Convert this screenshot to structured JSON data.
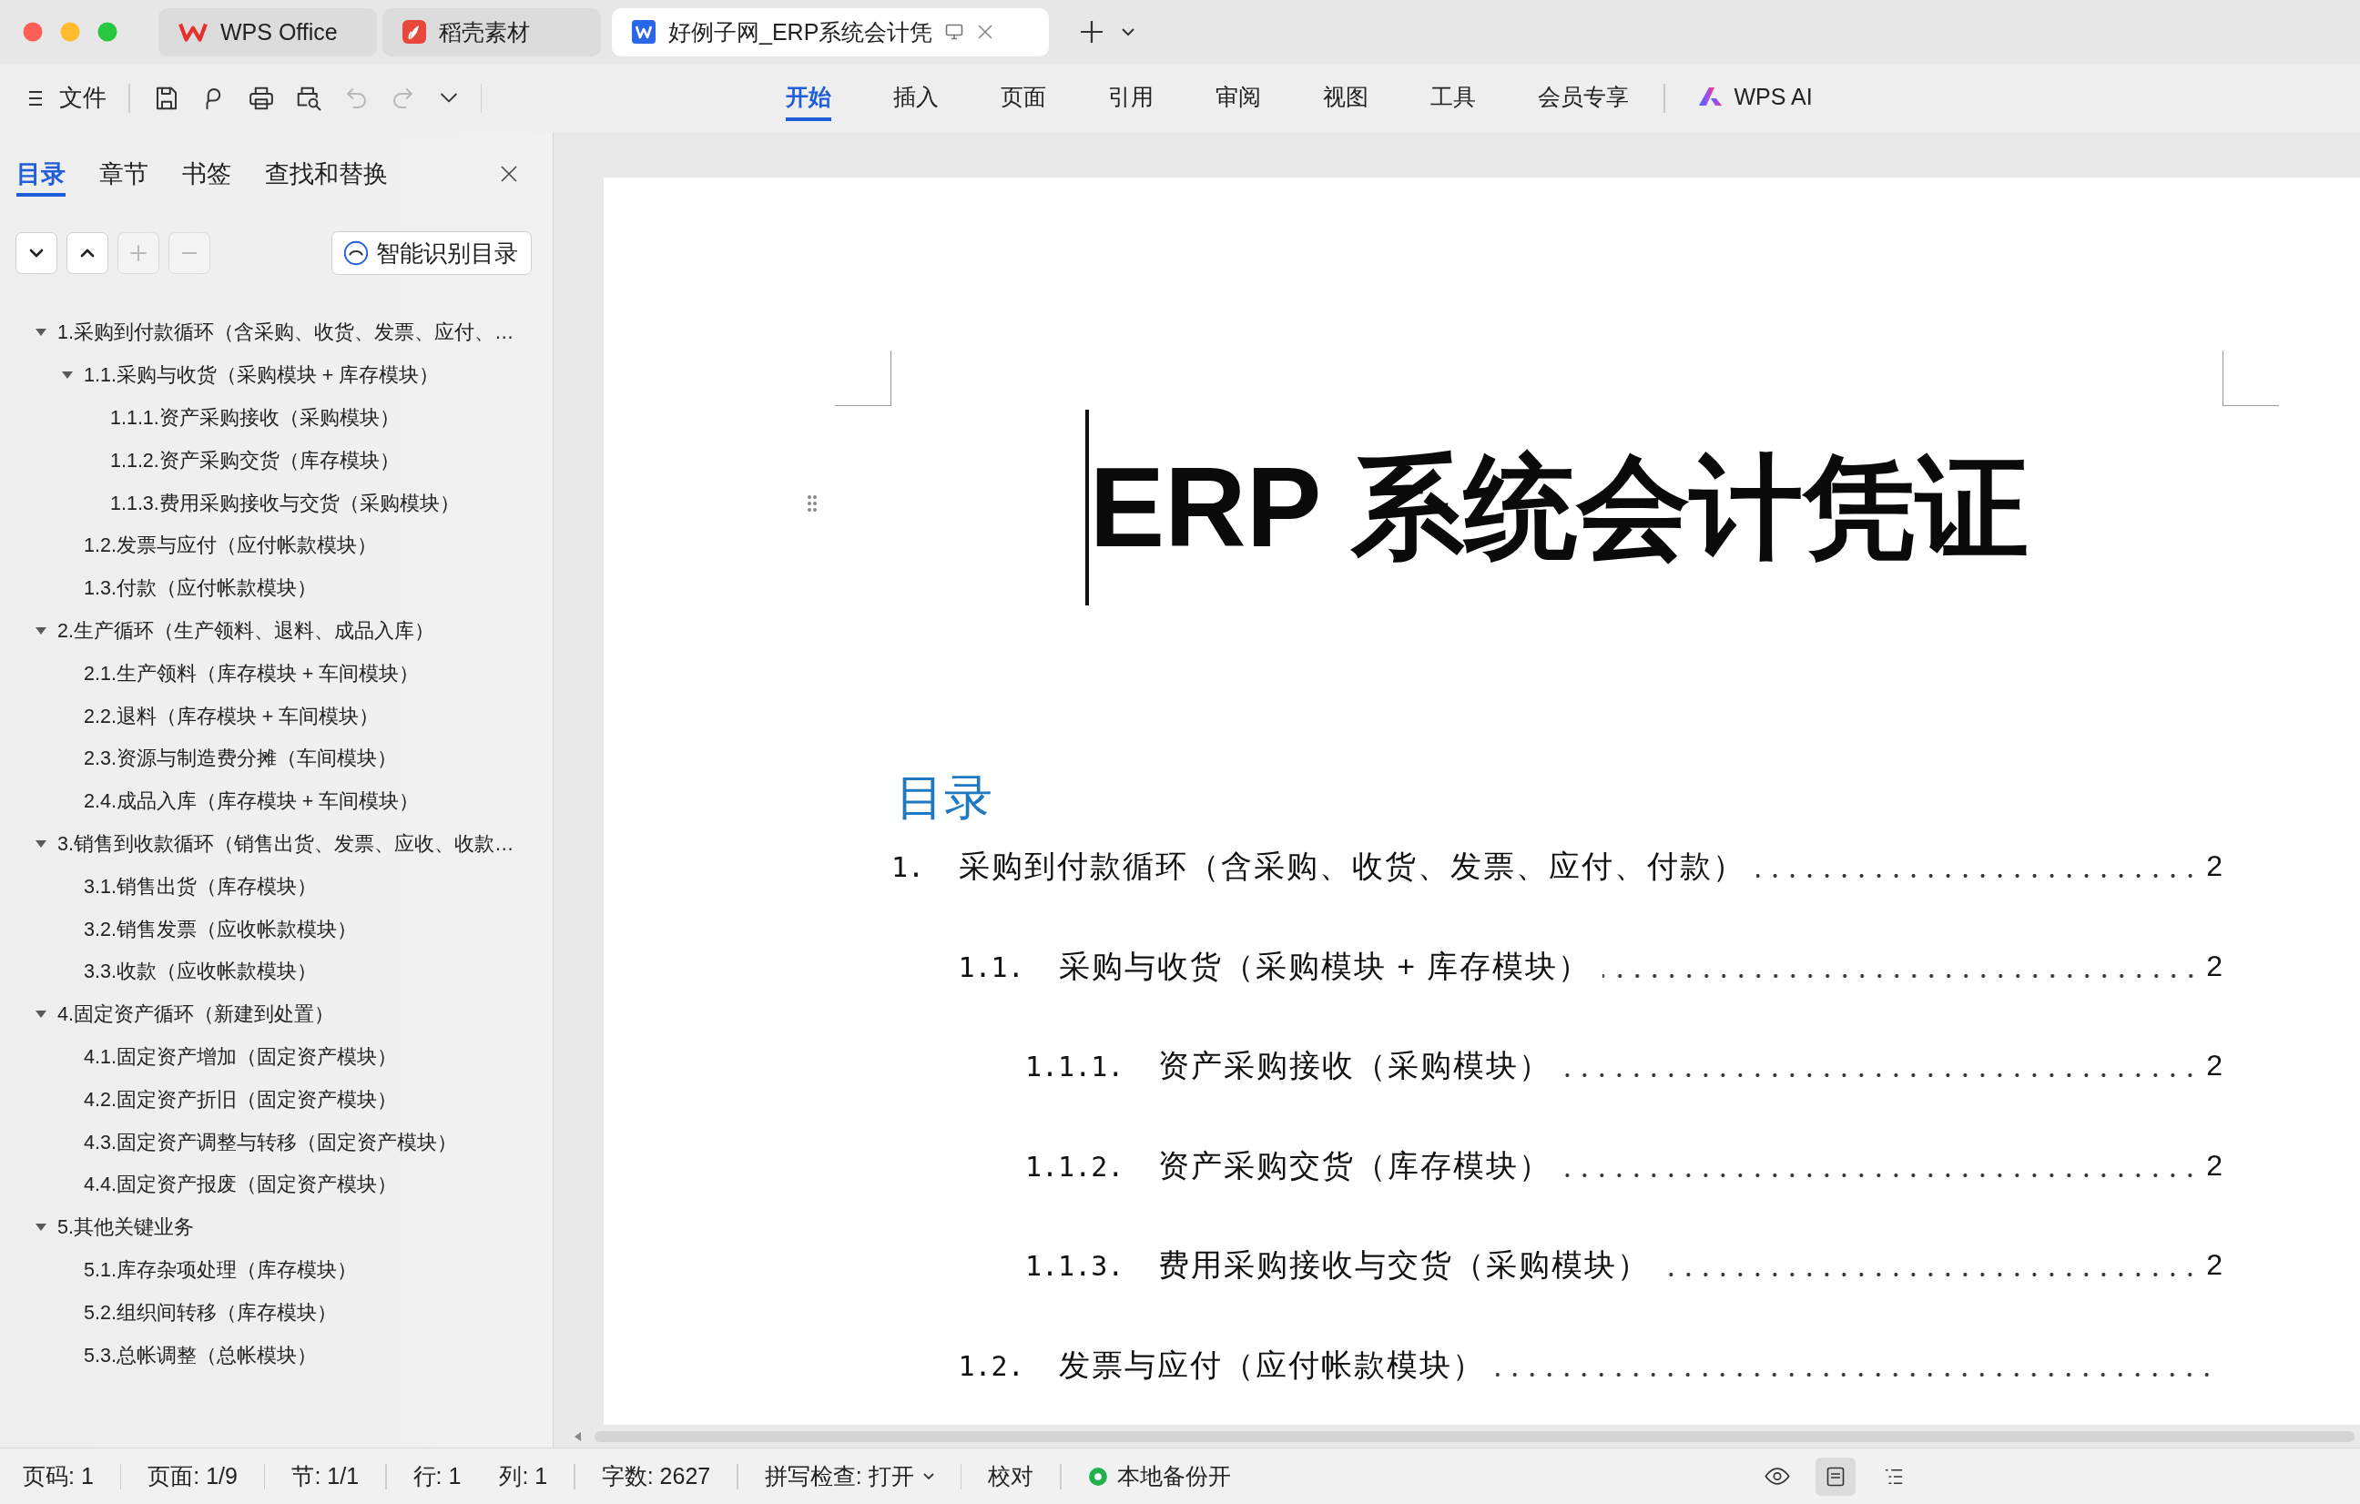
{
  "title_bar": {
    "tabs": [
      {
        "label": "WPS Office",
        "kind": "home",
        "selected": false
      },
      {
        "label": "稻壳素材",
        "kind": "store",
        "selected": false
      },
      {
        "label": "好例子网_ERP系统会计凭",
        "kind": "document",
        "selected": true
      }
    ]
  },
  "toolbar": {
    "file_menu": "文件",
    "quick_tools": [
      {
        "kind": "save",
        "disabled": false
      },
      {
        "kind": "export",
        "disabled": false
      },
      {
        "kind": "print",
        "disabled": false
      },
      {
        "kind": "preview",
        "disabled": false
      },
      {
        "kind": "undo",
        "disabled": true
      },
      {
        "kind": "redo",
        "disabled": true
      },
      {
        "kind": "more",
        "disabled": false
      }
    ],
    "ribbon_tabs": [
      {
        "label": "开始",
        "kind": "tab",
        "selected": true
      },
      {
        "label": "插入",
        "kind": "tab",
        "selected": false
      },
      {
        "label": "页面",
        "kind": "tab",
        "selected": false
      },
      {
        "label": "引用",
        "kind": "tab",
        "selected": false
      },
      {
        "label": "审阅",
        "kind": "tab",
        "selected": false
      },
      {
        "label": "视图",
        "kind": "tab",
        "selected": false
      },
      {
        "label": "工具",
        "kind": "tab",
        "selected": false
      },
      {
        "label": "会员专享",
        "kind": "tab",
        "selected": false
      },
      {
        "label": "WPS AI",
        "kind": "ai",
        "selected": false
      }
    ]
  },
  "sidebar": {
    "tabs": [
      {
        "label": "目录",
        "selected": true
      },
      {
        "label": "章节",
        "selected": false
      },
      {
        "label": "书签",
        "selected": false
      },
      {
        "label": "查找和替换",
        "selected": false
      }
    ],
    "tools": [
      {
        "kind": "down",
        "disabled": false
      },
      {
        "kind": "up",
        "disabled": false
      },
      {
        "kind": "add",
        "disabled": true
      },
      {
        "kind": "remove",
        "disabled": true
      }
    ],
    "smart_button": "智能识别目录",
    "tree": [
      {
        "label": "1.采购到付款循环（含采购、收货、发票、应付、…",
        "expanded": true,
        "children": [
          {
            "label": "1.1.采购与收货（采购模块 + 库存模块）",
            "expanded": true,
            "children": [
              {
                "label": "1.1.1.资产采购接收（采购模块）"
              },
              {
                "label": "1.1.2.资产采购交货（库存模块）"
              },
              {
                "label": "1.1.3.费用采购接收与交货（采购模块）"
              }
            ]
          },
          {
            "label": "1.2.发票与应付（应付帐款模块）"
          },
          {
            "label": "1.3.付款（应付帐款模块）"
          }
        ]
      },
      {
        "label": "2.生产循环（生产领料、退料、成品入库）",
        "expanded": true,
        "children": [
          {
            "label": "2.1.生产领料（库存模块 + 车间模块）"
          },
          {
            "label": "2.2.退料（库存模块 + 车间模块）"
          },
          {
            "label": "2.3.资源与制造费分摊（车间模块）"
          },
          {
            "label": "2.4.成品入库（库存模块 + 车间模块）"
          }
        ]
      },
      {
        "label": "3.销售到收款循环（销售出货、发票、应收、收款…",
        "expanded": true,
        "children": [
          {
            "label": "3.1.销售出货（库存模块）"
          },
          {
            "label": "3.2.销售发票（应收帐款模块）"
          },
          {
            "label": "3.3.收款（应收帐款模块）"
          }
        ]
      },
      {
        "label": "4.固定资产循环（新建到处置）",
        "expanded": true,
        "children": [
          {
            "label": "4.1.固定资产增加（固定资产模块）"
          },
          {
            "label": "4.2.固定资产折旧（固定资产模块）"
          },
          {
            "label": "4.3.固定资产调整与转移（固定资产模块）"
          },
          {
            "label": "4.4.固定资产报废（固定资产模块）"
          }
        ]
      },
      {
        "label": "5.其他关键业务",
        "expanded": true,
        "children": [
          {
            "label": "5.1.库存杂项处理（库存模块）"
          },
          {
            "label": "5.2.组织间转移（库存模块）"
          },
          {
            "label": "5.3.总帐调整（总帐模块）"
          }
        ]
      }
    ]
  },
  "document": {
    "title": "ERP 系统会计凭证",
    "toc_heading": "目录",
    "toc": [
      {
        "number": "1.",
        "text": "采购到付款循环（含采购、收货、发票、应付、付款）",
        "page": "2",
        "children": [
          {
            "number": "1.1.",
            "text": "采购与收货（采购模块 + 库存模块）",
            "page": "2",
            "children": [
              {
                "number": "1.1.1.",
                "text": "资产采购接收（采购模块）",
                "page": "2"
              },
              {
                "number": "1.1.2.",
                "text": "资产采购交货（库存模块）",
                "page": "2"
              },
              {
                "number": "1.1.3.",
                "text": "费用采购接收与交货（采购模块）",
                "page": "2"
              }
            ]
          },
          {
            "number": "1.2.",
            "text": "发票与应付（应付帐款模块）"
          }
        ]
      }
    ]
  },
  "status_bar": {
    "groups": [
      {
        "items": [
          {
            "kind": "text",
            "text": "页码: 1"
          }
        ]
      },
      {
        "items": [
          {
            "kind": "text",
            "text": "页面: 1/9"
          }
        ]
      },
      {
        "items": [
          {
            "kind": "text",
            "text": "节: 1/1"
          }
        ]
      },
      {
        "items": [
          {
            "kind": "text",
            "text": "行: 1"
          },
          {
            "kind": "text",
            "text": "列: 1"
          }
        ]
      },
      {
        "items": [
          {
            "kind": "text",
            "text": "字数: 2627"
          }
        ]
      },
      {
        "items": [
          {
            "kind": "dropdown",
            "text": "拼写检查: 打开"
          }
        ]
      },
      {
        "items": [
          {
            "kind": "button",
            "text": "校对"
          }
        ]
      },
      {
        "items": [
          {
            "kind": "status",
            "text": "本地备份开"
          }
        ]
      }
    ],
    "view_buttons": [
      {
        "kind": "reading",
        "selected": false
      },
      {
        "kind": "page",
        "selected": true
      },
      {
        "kind": "outline",
        "selected": false
      }
    ]
  }
}
